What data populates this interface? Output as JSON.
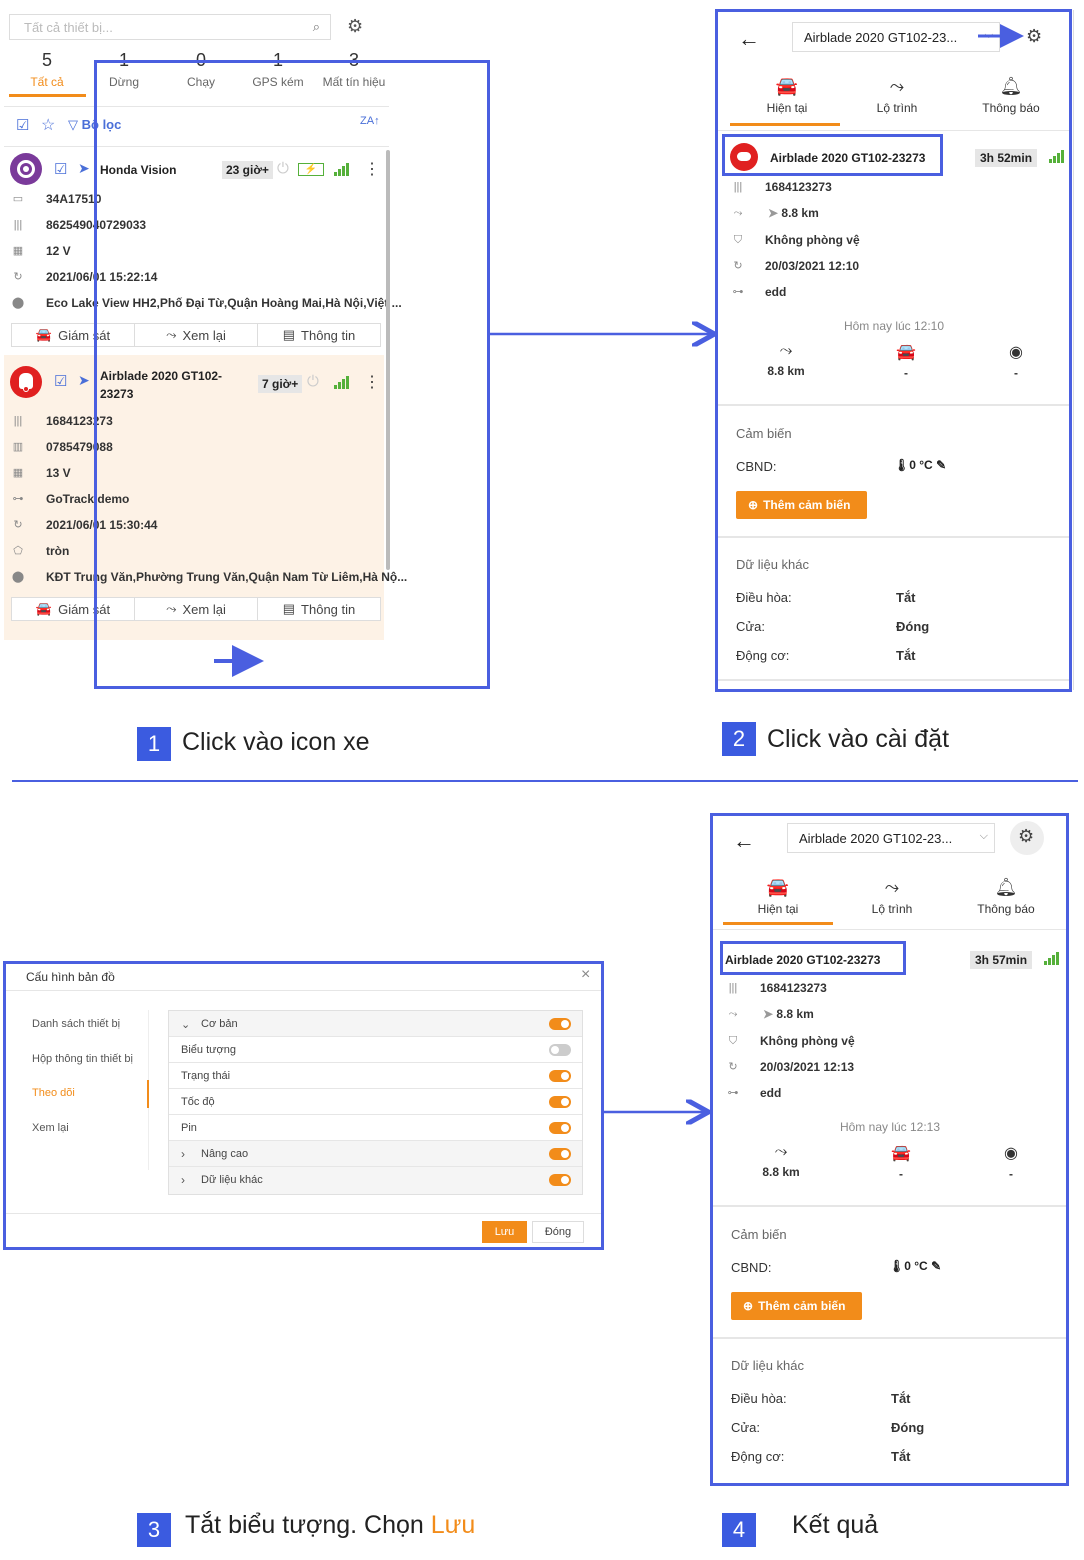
{
  "panel1": {
    "search_placeholder": "Tất cả thiết bị...",
    "tabs": [
      {
        "count": "5",
        "label": "Tất cả"
      },
      {
        "count": "1",
        "label": "Dừng"
      },
      {
        "count": "0",
        "label": "Chạy"
      },
      {
        "count": "1",
        "label": "GPS kém"
      },
      {
        "count": "3",
        "label": "Mất tín hiệu"
      }
    ],
    "filter_label": "Bộ lọc",
    "sort_label": "ZA",
    "device1": {
      "name": "Honda Vision",
      "badge": "23 giờ+",
      "plate": "34A17510",
      "imei": "862549040729033",
      "voltage": "12 V",
      "time": "2021/06/01 15:22:14",
      "address": "Eco Lake View HH2,Phố Đại Từ,Quận Hoàng Mai,Hà Nội,Việt ..."
    },
    "device2": {
      "name_line1": "Airblade 2020 GT102-",
      "name_line2": "23273",
      "badge": "7 giờ+",
      "imei": "1684123273",
      "sim": "0785479088",
      "voltage": "13 V",
      "group": "GoTrack demo",
      "time": "2021/06/01 15:30:44",
      "zone": "tròn",
      "address": "KĐT Trung Văn,Phường Trung Văn,Quận Nam Từ Liêm,Hà Nộ..."
    },
    "btn_monitor": "Giám sát",
    "btn_replay": "Xem lại",
    "btn_info": "Thông tin"
  },
  "panel2": {
    "device_select": "Airblade 2020 GT102-23...",
    "tabs": [
      "Hiện tại",
      "Lộ trình",
      "Thông báo"
    ],
    "device_name": "Airblade 2020 GT102-23273",
    "duration": "3h 52min",
    "imei": "1684123273",
    "distance": "8.8 km",
    "guard": "Không phòng vệ",
    "time": "20/03/2021 12:10",
    "group": "edd",
    "today": "Hôm nay lúc 12:10",
    "stat_distance": "8.8 km",
    "stat_car": "-",
    "stat_stop": "-",
    "sensor_title": "Cảm biến",
    "sensor_key": "CBND:",
    "sensor_val": "0 °C",
    "add_sensor": "Thêm cảm biến",
    "other_title": "Dữ liệu khác",
    "other": [
      {
        "k": "Điều hòa:",
        "v": "Tắt"
      },
      {
        "k": "Cửa:",
        "v": "Đóng"
      },
      {
        "k": "Động cơ:",
        "v": "Tắt"
      }
    ]
  },
  "panel3": {
    "title": "Cấu hình bản đồ",
    "close": "×",
    "menu": [
      "Danh sách thiết bị",
      "Hộp thông tin thiết bị",
      "Theo dõi",
      "Xem lại"
    ],
    "rows": [
      {
        "label": "Cơ bản",
        "prefix": "⌄",
        "on": true
      },
      {
        "label": "Biểu tượng",
        "prefix": "",
        "on": false
      },
      {
        "label": "Trạng thái",
        "prefix": "",
        "on": true
      },
      {
        "label": "Tốc độ",
        "prefix": "",
        "on": true
      },
      {
        "label": "Pin",
        "prefix": "",
        "on": true
      },
      {
        "label": "Nâng cao",
        "prefix": "›",
        "on": true
      },
      {
        "label": "Dữ liệu khác",
        "prefix": "›",
        "on": true
      }
    ],
    "save": "Lưu",
    "close_btn": "Đóng"
  },
  "panel4": {
    "device_select": "Airblade 2020 GT102-23...",
    "tabs": [
      "Hiện tại",
      "Lộ trình",
      "Thông báo"
    ],
    "device_name": "Airblade 2020 GT102-23273",
    "duration": "3h 57min",
    "imei": "1684123273",
    "distance": "8.8 km",
    "guard": "Không phòng vệ",
    "time": "20/03/2021 12:13",
    "group": "edd",
    "today": "Hôm nay lúc 12:13",
    "stat_distance": "8.8 km",
    "stat_car": "-",
    "stat_stop": "-",
    "sensor_title": "Cảm biến",
    "sensor_key": "CBND:",
    "sensor_val": "0 °C",
    "add_sensor": "Thêm cảm biến",
    "other_title": "Dữ liệu khác",
    "other": [
      {
        "k": "Điều hòa:",
        "v": "Tắt"
      },
      {
        "k": "Cửa:",
        "v": "Đóng"
      },
      {
        "k": "Động cơ:",
        "v": "Tắt"
      }
    ]
  },
  "steps": [
    {
      "num": "1",
      "text": "Click vào icon xe"
    },
    {
      "num": "2",
      "text": "Click vào cài đặt"
    },
    {
      "num": "3",
      "text": "Tắt biểu tượng. Chọn ",
      "highlight": "Lưu"
    },
    {
      "num": "4",
      "text": "Kết quả"
    }
  ],
  "colors": {
    "accent": "#f28c1a",
    "frame": "#4a5fe0",
    "signal": "#55b03a",
    "danger": "#e02020",
    "purple": "#7a3a9a"
  }
}
